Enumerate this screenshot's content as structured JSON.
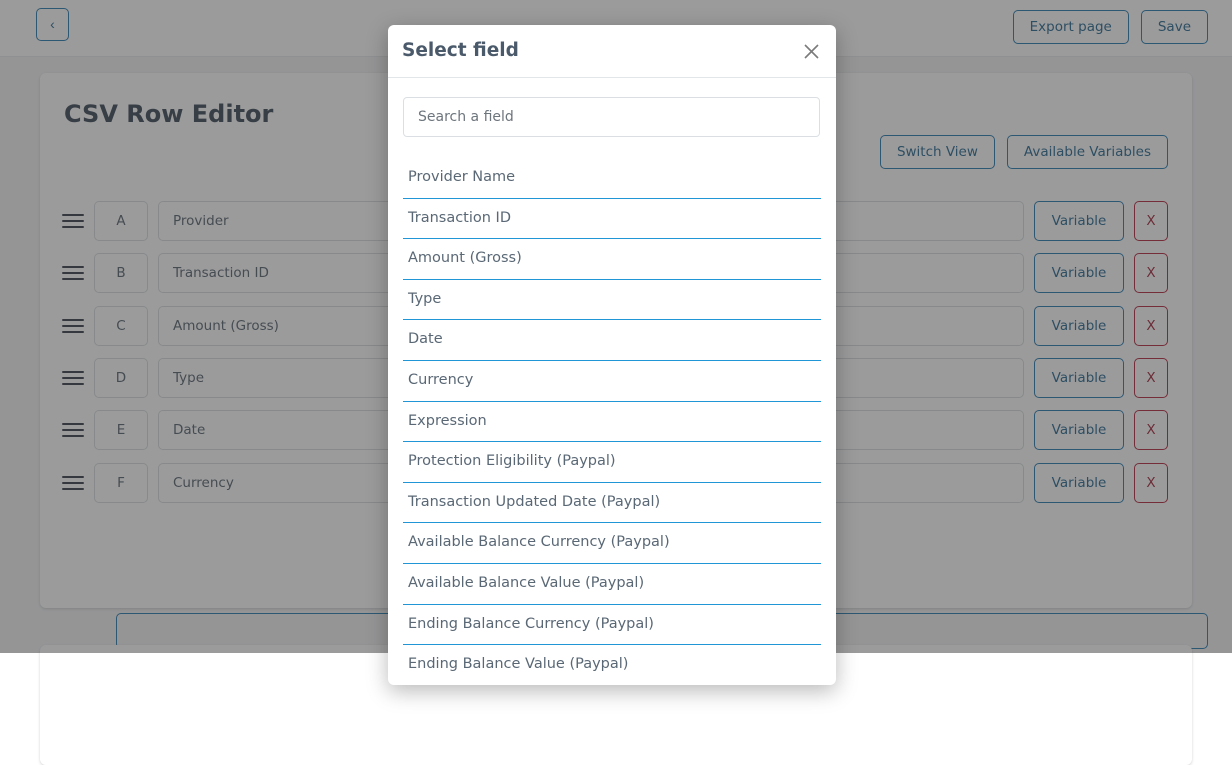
{
  "topbar": {
    "back_label": "‹",
    "back_icon": "chevron-left-icon",
    "export_label": "Export page",
    "save_label": "Save"
  },
  "editor": {
    "title": "CSV Row Editor",
    "switch_view_label": "Switch View",
    "available_variables_label": "Available Variables",
    "add_row_label": "",
    "variable_label": "Variable",
    "remove_label": "X",
    "rows": [
      {
        "letter": "A",
        "name": "Provider",
        "value": ""
      },
      {
        "letter": "B",
        "name": "Transaction ID",
        "value": ""
      },
      {
        "letter": "C",
        "name": "Amount (Gross)",
        "value": ""
      },
      {
        "letter": "D",
        "name": "Type",
        "value": ""
      },
      {
        "letter": "E",
        "name": "Date",
        "value": ""
      },
      {
        "letter": "F",
        "name": "Currency",
        "value": ""
      }
    ]
  },
  "modal": {
    "title": "Select field",
    "close_icon": "close-icon",
    "search": {
      "placeholder": "Search a field",
      "value": ""
    },
    "fields": [
      "Provider Name",
      "Transaction ID",
      "Amount (Gross)",
      "Type",
      "Date",
      "Currency",
      "Expression",
      "Protection Eligibility (Paypal)",
      "Transaction Updated Date (Paypal)",
      "Available Balance Currency (Paypal)",
      "Available Balance Value (Paypal)",
      "Ending Balance Currency (Paypal)",
      "Ending Balance Value (Paypal)"
    ]
  },
  "colors": {
    "accent_blue": "#1a73ab",
    "list_divider_blue": "#2196d6",
    "danger_red": "#b01b33",
    "page_bg": "#f2f3f5",
    "overlay": "rgba(64,64,64,0.52)"
  }
}
